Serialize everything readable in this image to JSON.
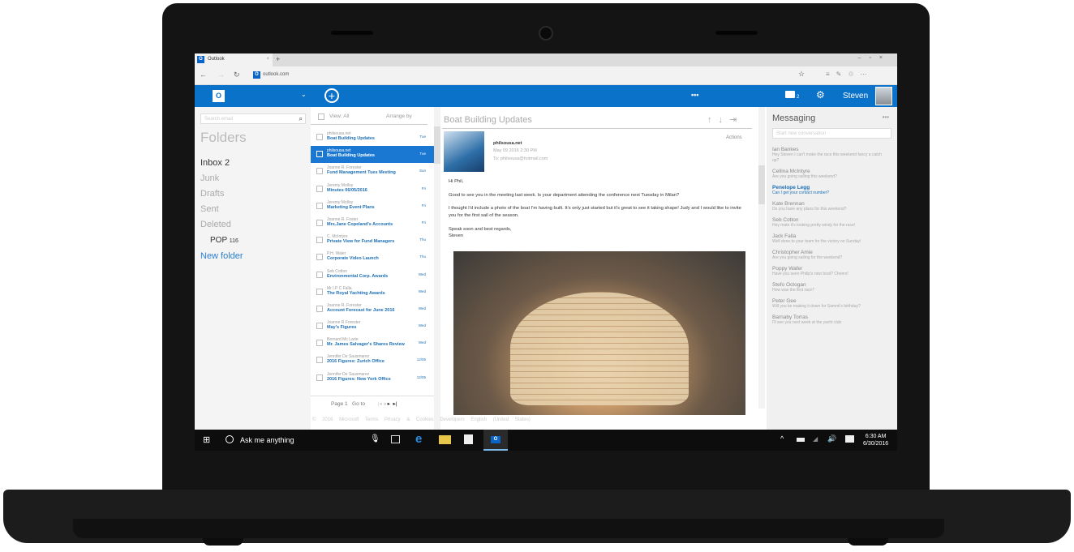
{
  "browser": {
    "tab_title": "Outlook",
    "url": "outlook.com"
  },
  "header": {
    "user_name": "Steven",
    "chat_badge": "2"
  },
  "folders": {
    "search_placeholder": "Search email",
    "title": "Folders",
    "items": [
      {
        "label": "Inbox",
        "count": "2"
      },
      {
        "label": "Junk"
      },
      {
        "label": "Drafts"
      },
      {
        "label": "Sent"
      },
      {
        "label": "Deleted"
      },
      {
        "label": "POP",
        "count": "116"
      }
    ],
    "new_folder": "New folder"
  },
  "list": {
    "view_label": "View: All",
    "arrange_label": "Arrange by",
    "page_label": "Page 1",
    "goto_label": "Go to",
    "rows": [
      {
        "sender": "philsousa.net",
        "subject": "Boat Building Updates",
        "date": "Tue"
      },
      {
        "sender": "philsousa.net",
        "subject": "Boat Building Updates",
        "date": "Tue",
        "selected": true
      },
      {
        "sender": "Joanne R. Forester",
        "subject": "Fund Management Tues Meeting",
        "date": "Sun"
      },
      {
        "sender": "Jeremy Molloy",
        "subject": "Minutes 06/05/2016",
        "date": "Fri"
      },
      {
        "sender": "Jeremy Molloy",
        "subject": "Marketing Event Plans",
        "date": "Fri"
      },
      {
        "sender": "Joanne R. Foster",
        "subject": "Mrs.Jane Copeland's Accounts",
        "date": "Fri"
      },
      {
        "sender": "C. McIntyre",
        "subject": "Private View for Fund Managers",
        "date": "Thu"
      },
      {
        "sender": "P.H. Waler",
        "subject": "Corporate Video Launch",
        "date": "Thu"
      },
      {
        "sender": "Seb Cotton",
        "subject": "Environmental Corp. Awards",
        "date": "Wed"
      },
      {
        "sender": "Mr I.P C Falla",
        "subject": "The Royal Yachting Awards",
        "date": "Wed"
      },
      {
        "sender": "Joanne R. Forester",
        "subject": "Account Forecast for June 2016",
        "date": "Wed"
      },
      {
        "sender": "Joanne R Forester",
        "subject": "May's Figures",
        "date": "Wed"
      },
      {
        "sender": "Bernard Mc Larte",
        "subject": "Mr. James Salvager's Shares Review",
        "date": "Wed"
      },
      {
        "sender": "Jennifer De Sausmarez",
        "subject": "2016 Figures: Zurich Office",
        "date": "12/05"
      },
      {
        "sender": "Jennifer De Sausmarez",
        "subject": "2016 Figures: New York Office",
        "date": "12/05"
      }
    ]
  },
  "reading": {
    "subject": "Boat Building Updates",
    "actions": "Actions",
    "from": "philsousa.net",
    "date": "May 09 2016 2:30 PM",
    "to": "To: philsousa@hotmail.com",
    "body": [
      "Hi Phil,",
      "Good to see you in the meeting last week. Is your department attending the conference next Tuesday in Milan?",
      "I thought I'd include a photo of the boat I'm having built. It's only just started but it's great to see it taking shape! Judy and I would like to invite you for the first sail of the season.",
      "Speak soon and best regards,",
      "Steven"
    ]
  },
  "footer": "© 2016 Microsoft  Terms  Privacy & Cookies  Developers  English (United States)",
  "messaging": {
    "title": "Messaging",
    "placeholder": "Start new conversation",
    "items": [
      {
        "name": "Ian Bankes",
        "preview": "Hey Steven I can't make the race this weekend fancy a catch up?"
      },
      {
        "name": "Cellina McIntyre",
        "preview": "Are you going sailing this weekend?"
      },
      {
        "name": "Penelope Legg",
        "preview": "Can I get your contact number?",
        "highlight": true
      },
      {
        "name": "Kate Brennan",
        "preview": "Do you have any plans for this weekend?"
      },
      {
        "name": "Seb Cotton",
        "preview": "Hey mate it's looking pretty windy for the race!"
      },
      {
        "name": "Jack Falla",
        "preview": "Well done to your team for the victory on Sunday!"
      },
      {
        "name": "Christopher Amie",
        "preview": "Are you going sailing for the weekend?"
      },
      {
        "name": "Poppy Wafer",
        "preview": "Have you seen Philip's new boat? Cheers!"
      },
      {
        "name": "Stefo Octogan",
        "preview": "How was the first race?"
      },
      {
        "name": "Peter Gee",
        "preview": "Will you be making it down for Sammi's birthday?"
      },
      {
        "name": "Barnaby Torras",
        "preview": "I'll see you next week at the yacht club"
      }
    ]
  },
  "taskbar": {
    "search_text": "Ask me anything",
    "time": "6:30 AM",
    "date": "6/30/2016"
  },
  "colors": {
    "brand": "#0a72c9",
    "selected": "#1a78d2",
    "taskbar": "#0d0d0d"
  }
}
